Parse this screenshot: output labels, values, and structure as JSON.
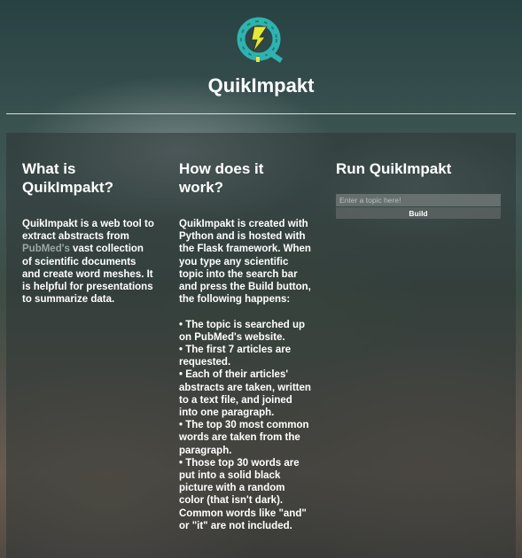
{
  "brand": {
    "logo_icon": "quikimpakt-logo-icon",
    "title": "QuikImpakt"
  },
  "about": {
    "heading": "What is QuikImpakt?",
    "text_before_link": "QuikImpakt is a web tool to extract abstracts from ",
    "link_text": "PubMed's",
    "text_after_link": " vast collection of scientific documents and create word meshes. It is helpful for presentations to summarize data."
  },
  "how": {
    "heading": "How does it work?",
    "intro": "QuikImpakt is created with Python and is hosted with the Flask framework. When you type any scientific topic into the search bar and press the Build button, the following happens:",
    "steps": [
      "• The topic is searched up on PubMed's website.",
      "• The first 7 articles are requested.",
      "• Each of their articles' abstracts are taken, written to a text file, and joined into one paragraph.",
      "• The top 30 most common words are taken from the paragraph.",
      "• Those top 30 words are put into a solid black picture with a random color (that isn't dark). Common words like \"and\" or \"it\" are not included."
    ]
  },
  "run": {
    "heading": "Run QuikImpakt",
    "input_placeholder": "Enter a topic here!",
    "input_value": "",
    "build_label": "Build"
  },
  "colors": {
    "logo_ring": "#2fb3b0",
    "logo_bolt": "#e4e83a",
    "link": "#9aa7a7"
  }
}
